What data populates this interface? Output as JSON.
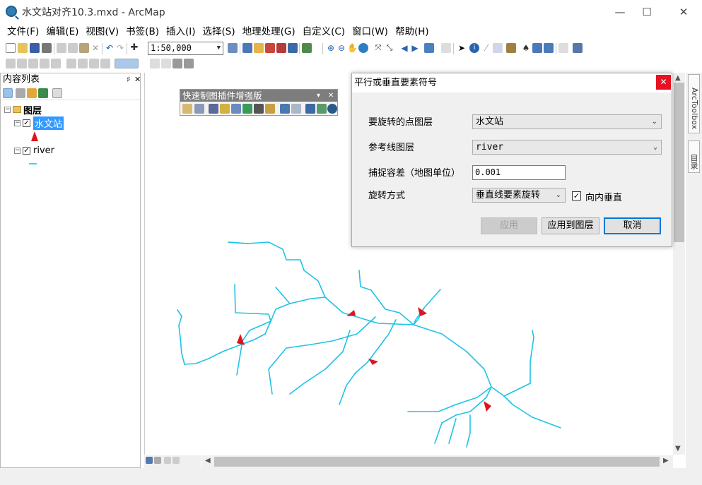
{
  "window": {
    "title": "水文站对齐10.3.mxd - ArcMap",
    "minimize": "—",
    "maximize": "☐",
    "close": "✕"
  },
  "menu": [
    "文件(F)",
    "编辑(E)",
    "视图(V)",
    "书签(B)",
    "插入(I)",
    "选择(S)",
    "地理处理(G)",
    "自定义(C)",
    "窗口(W)",
    "帮助(H)"
  ],
  "toolbar": {
    "scale": "1:50,000"
  },
  "toc": {
    "title": "内容列表",
    "pin": "♯",
    "close": "✕",
    "root_label": "图层",
    "layers": [
      {
        "name": "水文站",
        "checked": true,
        "selected": true
      },
      {
        "name": "river",
        "checked": true,
        "selected": false
      }
    ]
  },
  "quickbar": {
    "title": "快速制图插件增强版"
  },
  "dialog": {
    "title": "平行或垂直要素符号",
    "close": "✕",
    "point_layer_label": "要旋转的点图层",
    "point_layer_value": "水文站",
    "ref_layer_label": "参考线图层",
    "ref_layer_value": "river",
    "tolerance_label": "捕捉容差（地图单位）",
    "tolerance_value": "0.001",
    "rotation_label": "旋转方式",
    "rotation_value": "垂直线要素旋转",
    "inward_label": "向内垂直",
    "inward_checked": true,
    "btn_apply": "应用",
    "btn_apply_layer": "应用到图层",
    "btn_cancel": "取消"
  },
  "dock": {
    "arctoolbox": "ArcToolbox",
    "catalog": "目录"
  },
  "colors": {
    "river": "#00c8e8",
    "marker": "#e0141e",
    "selection": "#3399ff",
    "close_red": "#e81123"
  }
}
